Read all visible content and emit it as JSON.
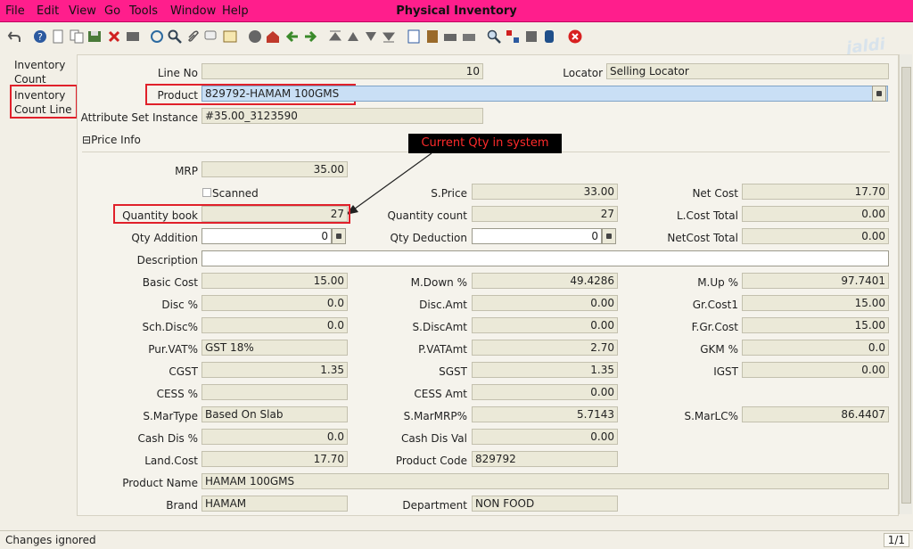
{
  "window": {
    "title": "Physical Inventory"
  },
  "menu": [
    "File",
    "Edit",
    "View",
    "Go",
    "Tools",
    "Window",
    "Help"
  ],
  "toolbar_icons": [
    "undo-icon",
    "help-icon",
    "new-icon",
    "copy-icon",
    "save-icon",
    "delete-icon",
    "print-icon",
    "refresh-icon",
    "find-icon",
    "attachment-icon",
    "chat-icon",
    "history-icon",
    "home-icon",
    "back-icon",
    "previous-icon",
    "next-icon",
    "first-icon",
    "up-icon",
    "down-icon",
    "last-icon",
    "report-icon",
    "archive-icon",
    "print-preview-icon",
    "print-icon-2",
    "zoom-icon",
    "workflow-icon",
    "lock-icon",
    "database-icon",
    "close-icon"
  ],
  "watermark": "jaldi",
  "tabs": [
    "Inventory Count",
    "Inventory Count Line"
  ],
  "form": {
    "line_no": {
      "label": "Line No",
      "value": "10"
    },
    "locator": {
      "label": "Locator",
      "value": "Selling Locator"
    },
    "product": {
      "label": "Product",
      "value": "829792-HAMAM 100GMS"
    },
    "attribute_set_instance": {
      "label": "Attribute Set Instance",
      "value": "#35.00_3123590"
    }
  },
  "section": {
    "label": "Price Info"
  },
  "price_info": {
    "mrp": {
      "label": "MRP",
      "value": "35.00"
    },
    "scanned": {
      "label": "Scanned",
      "checked": false
    },
    "s_price": {
      "label": "S.Price",
      "value": "33.00"
    },
    "net_cost": {
      "label": "Net Cost",
      "value": "17.70"
    },
    "quantity_book": {
      "label": "Quantity book",
      "value": "27"
    },
    "quantity_count": {
      "label": "Quantity count",
      "value": "27"
    },
    "l_cost_total": {
      "label": "L.Cost Total",
      "value": "0.00"
    },
    "qty_addition": {
      "label": "Qty Addition",
      "value": "0"
    },
    "qty_deduction": {
      "label": "Qty Deduction",
      "value": "0"
    },
    "net_cost_total": {
      "label": "NetCost Total",
      "value": "0.00"
    },
    "description": {
      "label": "Description",
      "value": ""
    },
    "basic_cost": {
      "label": "Basic Cost",
      "value": "15.00"
    },
    "m_down": {
      "label": "M.Down %",
      "value": "49.4286"
    },
    "m_up": {
      "label": "M.Up %",
      "value": "97.7401"
    },
    "disc_pct": {
      "label": "Disc %",
      "value": "0.0"
    },
    "disc_amt": {
      "label": "Disc.Amt",
      "value": "0.00"
    },
    "gr_cost1": {
      "label": "Gr.Cost1",
      "value": "15.00"
    },
    "sch_disc": {
      "label": "Sch.Disc%",
      "value": "0.0"
    },
    "s_disc_amt": {
      "label": "S.DiscAmt",
      "value": "0.00"
    },
    "f_gr_cost": {
      "label": "F.Gr.Cost",
      "value": "15.00"
    },
    "pur_vat": {
      "label": "Pur.VAT%",
      "value": "GST 18%"
    },
    "p_vat_amt": {
      "label": "P.VATAmt",
      "value": "2.70"
    },
    "gkm": {
      "label": "GKM %",
      "value": "0.0"
    },
    "cgst": {
      "label": "CGST",
      "value": "1.35"
    },
    "sgst": {
      "label": "SGST",
      "value": "1.35"
    },
    "igst": {
      "label": "IGST",
      "value": "0.00"
    },
    "cess_pct": {
      "label": "CESS %",
      "value": ""
    },
    "cess_amt": {
      "label": "CESS Amt",
      "value": "0.00"
    },
    "s_mar_type": {
      "label": "S.MarType",
      "value": "Based On Slab"
    },
    "s_mar_mrp": {
      "label": "S.MarMRP%",
      "value": "5.7143"
    },
    "s_mar_lc": {
      "label": "S.MarLC%",
      "value": "86.4407"
    },
    "cash_dis_pct": {
      "label": "Cash Dis %",
      "value": "0.0"
    },
    "cash_dis_val": {
      "label": "Cash Dis Val",
      "value": "0.00"
    },
    "land_cost": {
      "label": "Land.Cost",
      "value": "17.70"
    },
    "product_code": {
      "label": "Product Code",
      "value": "829792"
    },
    "product_name": {
      "label": "Product Name",
      "value": "HAMAM 100GMS"
    },
    "brand": {
      "label": "Brand",
      "value": "HAMAM"
    },
    "department": {
      "label": "Department",
      "value": "NON FOOD"
    }
  },
  "annotation": {
    "callout": "Current Qty in system"
  },
  "status": {
    "message": "Changes ignored",
    "page": "1/1"
  },
  "colors": {
    "title_bar": "#ff1e8c",
    "highlight": "#e0202a",
    "field_bg": "#ebe9d8"
  }
}
